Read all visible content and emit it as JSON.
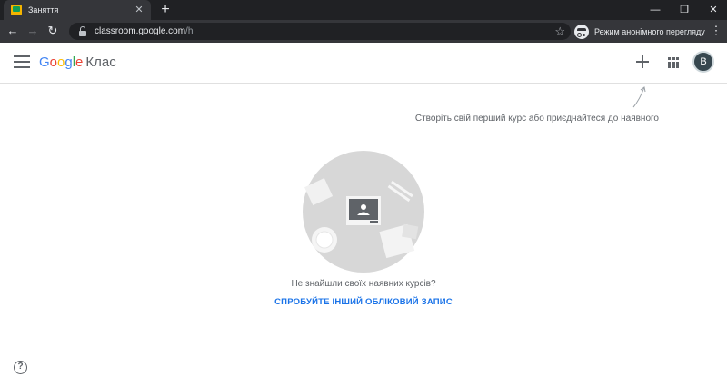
{
  "browser": {
    "tab": {
      "title": "Заняття",
      "close_glyph": "✕"
    },
    "new_tab_glyph": "+",
    "window_controls": {
      "minimize": "—",
      "maximize": "❐",
      "close": "✕"
    },
    "nav": {
      "back": "←",
      "forward": "→",
      "reload": "↻"
    },
    "url": {
      "host": "classroom.google.com",
      "path": "/h"
    },
    "bookmark_glyph": "☆",
    "incognito_label": "Режим анонімного перегляду",
    "menu_glyph": "⋮"
  },
  "header": {
    "logo": {
      "letters": [
        "G",
        "o",
        "o",
        "g",
        "l",
        "e"
      ],
      "colors": [
        "#4285f4",
        "#ea4335",
        "#fbbc05",
        "#4285f4",
        "#34a853",
        "#ea4335"
      ]
    },
    "product": "Клас",
    "avatar_initial": "B"
  },
  "main": {
    "hint": "Створіть свій перший курс або приєднайтеся до наявного",
    "empty_message": "Не знайшли своїх наявних курсів?",
    "switch_account": "СПРОБУЙТЕ ІНШИЙ ОБЛІКОВИЙ ЗАПИС"
  },
  "help_glyph": "?",
  "colors": {
    "chrome_dark": "#202124",
    "chrome_tab": "#35363a",
    "link_blue": "#1a73e8",
    "illustration_gray": "#d7d7d7"
  }
}
